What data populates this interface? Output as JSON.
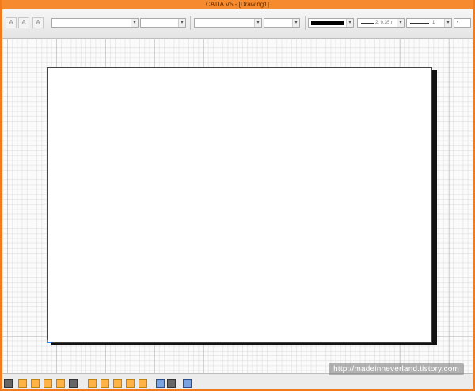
{
  "window": {
    "title": "CATIA V5 - [Drawing1]"
  },
  "toolbar": {
    "line_thickness": "2: 0.35 r",
    "line_type": "1",
    "point_style": "•",
    "line_color": "#000000"
  },
  "watermark": {
    "text": "http://madeinneverland.tistory.com"
  },
  "colors": {
    "frame": "#f07a1c",
    "titlebar": "#f58a2e",
    "sheet_origin": "#2a8cff"
  }
}
